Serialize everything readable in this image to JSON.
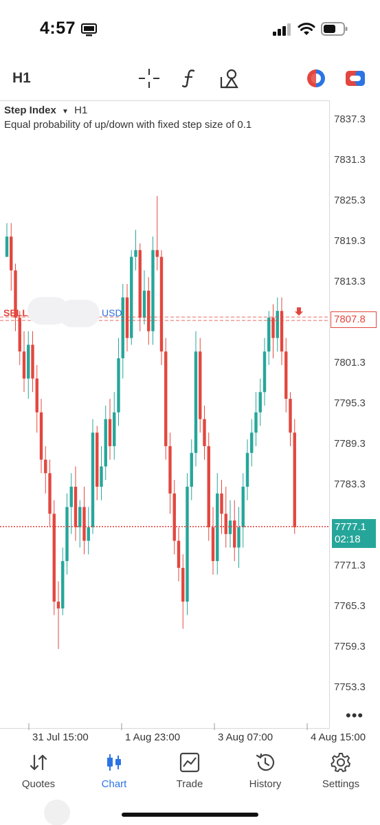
{
  "status_bar": {
    "time": "4:57"
  },
  "toolbar": {
    "timeframe": "H1",
    "icons": [
      "crosshair-icon",
      "indicator-f-icon",
      "drawing-objects-icon",
      "trading-circle-icon",
      "account-switch-icon"
    ]
  },
  "chart": {
    "symbol": "Step Index",
    "timeframe": "H1",
    "description": "Equal probability of up/down with fixed step size of 0.1",
    "sell_line": {
      "label": "SELL",
      "suffix": "USD",
      "price_tag": "7807.8"
    },
    "current": {
      "price": "7777.1",
      "timer": "02:18"
    },
    "price_axis": [
      "7837.3",
      "7831.3",
      "7825.3",
      "7819.3",
      "7813.3",
      "7801.3",
      "7795.3",
      "7789.3",
      "7783.3",
      "7771.3",
      "7765.3",
      "7759.3",
      "7753.3"
    ],
    "time_axis": [
      "31 Jul 15:00",
      "1 Aug 23:00",
      "3 Aug 07:00",
      "4 Aug 15:00"
    ],
    "colors": {
      "up": "#26a69a",
      "down": "#e2473f",
      "grid": "#d8d8d8"
    }
  },
  "chart_data": {
    "type": "candlestick",
    "series": [
      {
        "ohlc": [
          [
            7817,
            7820,
            7822,
            7817
          ],
          [
            7820,
            7815,
            7822,
            7812
          ],
          [
            7815,
            7808,
            7816,
            7806
          ],
          [
            7808,
            7803,
            7809,
            7801
          ],
          [
            7803,
            7799,
            7806,
            7797
          ],
          [
            7799,
            7804,
            7806,
            7796
          ],
          [
            7804,
            7799,
            7806,
            7797
          ],
          [
            7799,
            7794,
            7801,
            7791
          ],
          [
            7794,
            7787,
            7796,
            7785
          ],
          [
            7787,
            7785,
            7789,
            7782
          ],
          [
            7785,
            7779,
            7787,
            7777
          ],
          [
            7779,
            7766,
            7781,
            7764
          ],
          [
            7766,
            7765,
            7769,
            7759
          ],
          [
            7765,
            7772,
            7774,
            7764
          ],
          [
            7772,
            7780,
            7782,
            7770
          ],
          [
            7780,
            7783,
            7785,
            7776
          ],
          [
            7783,
            7777,
            7786,
            7775
          ],
          [
            7777,
            7780,
            7781,
            7774
          ],
          [
            7780,
            7775,
            7783,
            7773
          ],
          [
            7775,
            7777,
            7780,
            7773
          ],
          [
            7777,
            7791,
            7793,
            7776
          ],
          [
            7791,
            7783,
            7792,
            7781
          ],
          [
            7783,
            7786,
            7789,
            7781
          ],
          [
            7786,
            7793,
            7795,
            7784
          ],
          [
            7793,
            7789,
            7796,
            7787
          ],
          [
            7789,
            7794,
            7797,
            7787
          ],
          [
            7794,
            7802,
            7805,
            7792
          ],
          [
            7802,
            7811,
            7813,
            7799
          ],
          [
            7811,
            7805,
            7813,
            7803
          ],
          [
            7805,
            7817,
            7818,
            7804
          ],
          [
            7817,
            7818,
            7821,
            7815
          ],
          [
            7818,
            7808,
            7819,
            7806
          ],
          [
            7808,
            7812,
            7815,
            7807
          ],
          [
            7812,
            7806,
            7814,
            7804
          ],
          [
            7806,
            7818,
            7820,
            7804
          ],
          [
            7818,
            7817,
            7826,
            7815
          ],
          [
            7817,
            7803,
            7818,
            7801
          ],
          [
            7803,
            7789,
            7805,
            7787
          ],
          [
            7789,
            7782,
            7791,
            7779
          ],
          [
            7782,
            7775,
            7784,
            7773
          ],
          [
            7775,
            7771,
            7777,
            7769
          ],
          [
            7771,
            7766,
            7773,
            7762
          ],
          [
            7766,
            7783,
            7785,
            7764
          ],
          [
            7783,
            7788,
            7790,
            7781
          ],
          [
            7788,
            7803,
            7806,
            7786
          ],
          [
            7803,
            7793,
            7805,
            7791
          ],
          [
            7793,
            7789,
            7795,
            7787
          ],
          [
            7789,
            7777,
            7791,
            7775
          ],
          [
            7777,
            7772,
            7780,
            7770
          ],
          [
            7772,
            7782,
            7785,
            7770
          ],
          [
            7782,
            7779,
            7784,
            7776
          ],
          [
            7779,
            7776,
            7783,
            7774
          ],
          [
            7776,
            7778,
            7781,
            7774
          ],
          [
            7778,
            7774,
            7781,
            7772
          ],
          [
            7774,
            7777,
            7780,
            7771
          ],
          [
            7777,
            7783,
            7785,
            7774
          ],
          [
            7783,
            7788,
            7790,
            7781
          ],
          [
            7788,
            7791,
            7793,
            7786
          ],
          [
            7791,
            7794,
            7797,
            7789
          ],
          [
            7794,
            7797,
            7799,
            7792
          ],
          [
            7797,
            7803,
            7805,
            7795
          ],
          [
            7803,
            7808,
            7809,
            7801
          ],
          [
            7808,
            7805,
            7810,
            7802
          ],
          [
            7805,
            7809,
            7811,
            7803
          ],
          [
            7809,
            7803,
            7811,
            7801
          ],
          [
            7803,
            7796,
            7805,
            7794
          ],
          [
            7796,
            7791,
            7797,
            7789
          ],
          [
            7791,
            7777,
            7793,
            7776
          ]
        ]
      }
    ],
    "x_ticks": [
      "31 Jul 15:00",
      "1 Aug 23:00",
      "3 Aug 07:00",
      "4 Aug 15:00"
    ],
    "y_ticks": [
      7837.3,
      7831.3,
      7825.3,
      7819.3,
      7813.3,
      7807.8,
      7801.3,
      7795.3,
      7789.3,
      7783.3,
      7777.1,
      7771.3,
      7765.3,
      7759.3,
      7753.3
    ],
    "ylim": [
      7750,
      7840
    ],
    "horizontal_lines": [
      7807.8,
      7777.1
    ],
    "grid": false
  },
  "nav": {
    "items": [
      {
        "label": "Quotes",
        "icon": "quotes-arrows-icon",
        "active": false
      },
      {
        "label": "Chart",
        "icon": "chart-candles-icon",
        "active": true
      },
      {
        "label": "Trade",
        "icon": "trade-chart-icon",
        "active": false
      },
      {
        "label": "History",
        "icon": "history-clock-icon",
        "active": false
      },
      {
        "label": "Settings",
        "icon": "settings-gear-icon",
        "active": false
      }
    ]
  }
}
